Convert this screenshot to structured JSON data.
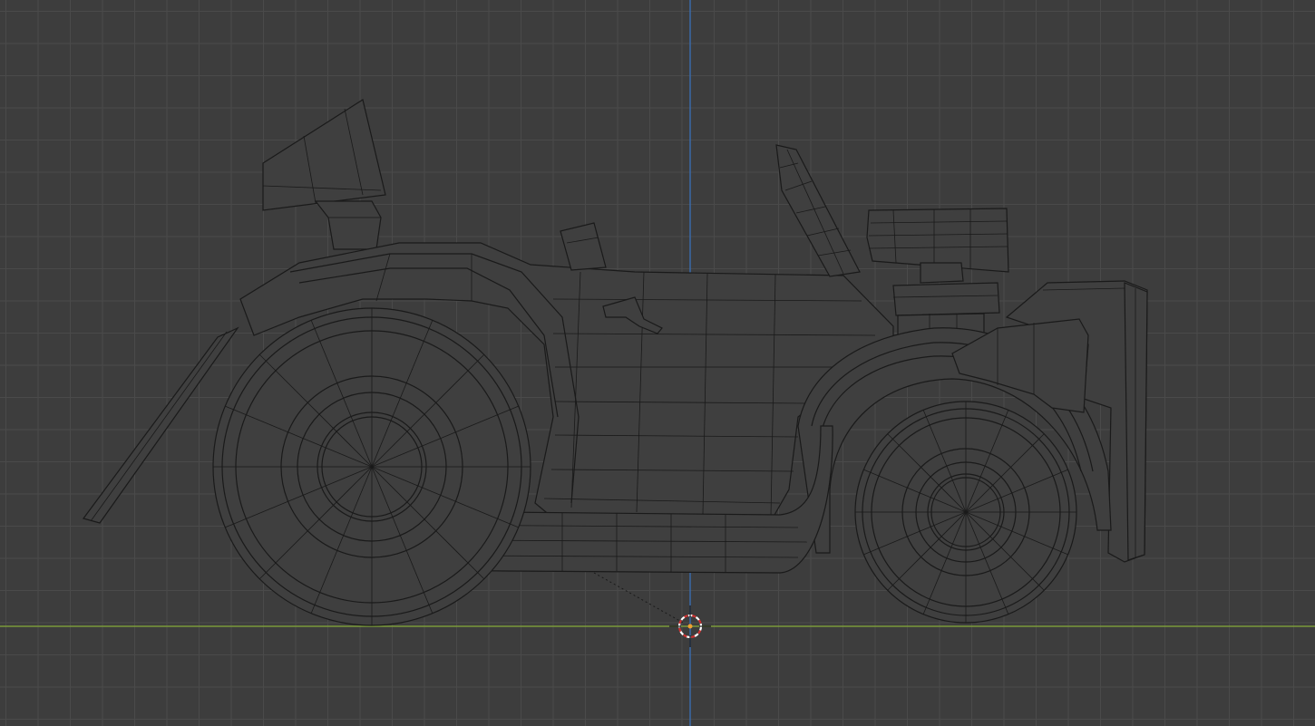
{
  "viewport": {
    "background_color": "#3d3d3d",
    "grid_color": "#4a4a4a",
    "x_axis_color": "#7a9a3a",
    "z_axis_color": "#3a6aa8",
    "wire_color": "#1a1a1a",
    "cursor_outer_color": "#ffffff",
    "cursor_inner_color": "#d03030"
  },
  "scene": {
    "object": "car-wireframe-mesh",
    "view": "side-orthographic",
    "mode": "wireframe"
  },
  "icons": {
    "cursor": "3d-cursor-icon"
  }
}
